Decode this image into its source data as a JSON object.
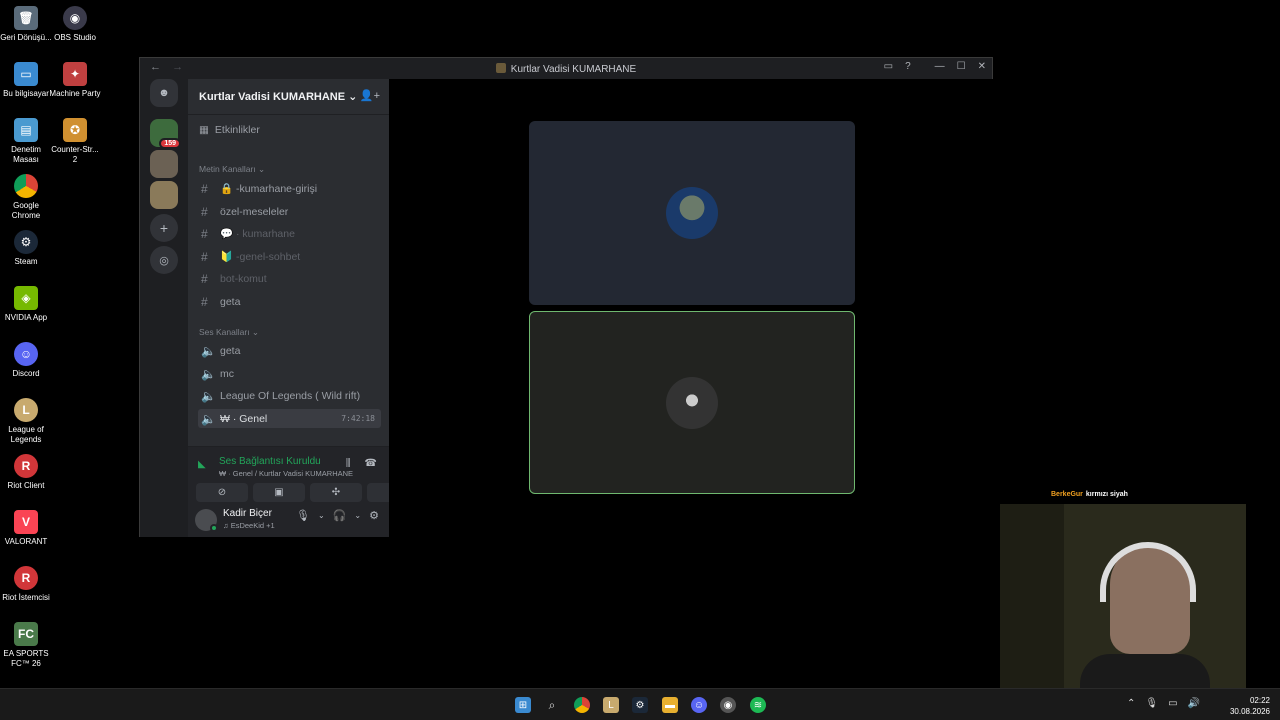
{
  "desktop": {
    "icons": [
      {
        "label": "Geri Dönüşü...",
        "icon": "recycle-bin-icon",
        "color": "#5a6b7a"
      },
      {
        "label": "OBS Studio",
        "icon": "obs-icon",
        "color": "#3a3a4a"
      },
      {
        "label": "Bu bilgisayar",
        "icon": "computer-icon",
        "color": "#3a8ad0"
      },
      {
        "label": "Machine Party",
        "icon": "machine-party-icon",
        "color": "#c04040"
      },
      {
        "label": "Denetim Masası",
        "icon": "control-panel-icon",
        "color": "#4a9ad0"
      },
      {
        "label": "Counter-Str... 2",
        "icon": "cs2-icon",
        "color": "#d09030"
      },
      {
        "label": "Google Chrome",
        "icon": "chrome-icon",
        "color": "#2f9a4a"
      },
      {
        "label": "Steam",
        "icon": "steam-icon",
        "color": "#1b2838"
      },
      {
        "label": "NVIDIA App",
        "icon": "nvidia-icon",
        "color": "#76b900"
      },
      {
        "label": "Discord",
        "icon": "discord-icon",
        "color": "#5865f2"
      },
      {
        "label": "League of Legends",
        "icon": "lol-icon",
        "color": "#c8aa6e"
      },
      {
        "label": "Riot Client",
        "icon": "riot-icon",
        "color": "#d13639"
      },
      {
        "label": "VALORANT",
        "icon": "valorant-icon",
        "color": "#fa4454"
      },
      {
        "label": "Riot İstemcisi",
        "icon": "riot-icon",
        "color": "#d13639"
      },
      {
        "label": "EA SPORTS FC™ 26",
        "icon": "ea-fc-icon",
        "color": "#4a7a4a"
      }
    ]
  },
  "window": {
    "title": "Kurtlar Vadisi KUMARHANE",
    "back": "←",
    "forward": "→",
    "ctrl_inbox": "▭",
    "ctrl_help": "?",
    "ctrl_min": "—",
    "ctrl_max": "☐",
    "ctrl_close": "✕"
  },
  "guilds": {
    "home_badge": "159"
  },
  "server": {
    "name": "Kurtlar Vadisi KUMARHANE ⌄",
    "invite_icon": "👤+",
    "events_label": "Etkinlikler",
    "text_category": "Metin Kanalları ⌄",
    "text_channels": [
      {
        "label": "🔒 -kumarhane-girişi"
      },
      {
        "label": "özel-meseleler"
      },
      {
        "label": "💬 · kumarhane"
      },
      {
        "label": "🔰 -genel-sohbet"
      },
      {
        "label": "bot-komut"
      },
      {
        "label": "geta"
      }
    ],
    "voice_category": "Ses Kanalları ⌄",
    "voice_channels": [
      {
        "label": "geta"
      },
      {
        "label": "mc"
      },
      {
        "label": "League Of Legends ( Wild rift)"
      },
      {
        "label": "₩ · Genel",
        "timer": "7:42:18"
      }
    ]
  },
  "voice": {
    "status": "Ses Bağlantısı Kuruldu",
    "sub": "₩ · Genel / Kurtlar Vadisi KUMARHANE"
  },
  "user": {
    "name": "Kadir Biçer",
    "status": "♫ EsDeeKid +1"
  },
  "camera": {
    "user": "BerkeGur",
    "text": "kırmızı siyah"
  },
  "clock": {
    "time": "02:22",
    "date": "30.08.2026"
  },
  "colors": {
    "accent_green": "#23a55a",
    "speaking_border": "#6fb86f"
  }
}
